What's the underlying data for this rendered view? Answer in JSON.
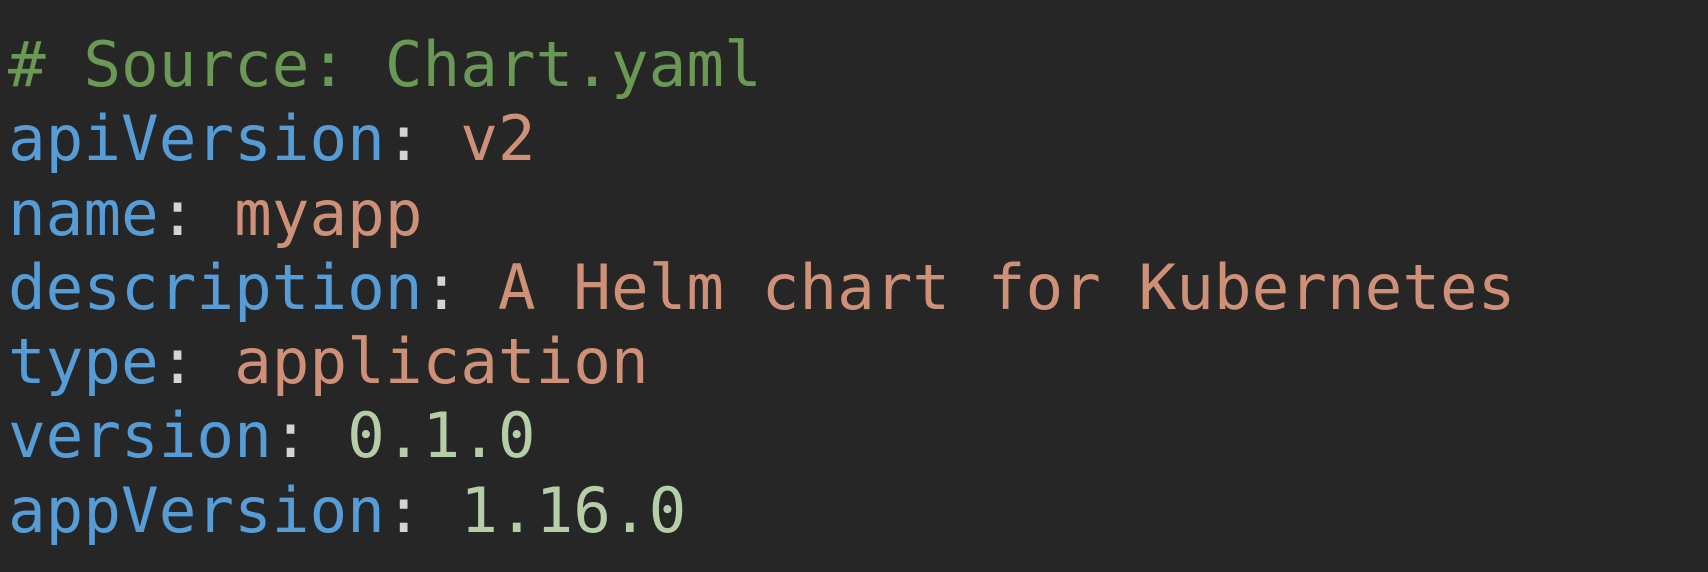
{
  "editor": {
    "language": "yaml",
    "theme": {
      "background": "#262626",
      "comment": "#6a9955",
      "key": "#569cd6",
      "punctuation": "#d4d4d4",
      "string": "#ce9178",
      "number": "#b5cea8"
    },
    "lines": [
      {
        "comment": "# Source: Chart.yaml"
      },
      {
        "key": "apiVersion",
        "sep": ": ",
        "value": "v2",
        "value_type": "string"
      },
      {
        "key": "name",
        "sep": ": ",
        "value": "myapp",
        "value_type": "string"
      },
      {
        "key": "description",
        "sep": ": ",
        "value": "A Helm chart for Kubernetes",
        "value_type": "string"
      },
      {
        "key": "type",
        "sep": ": ",
        "value": "application",
        "value_type": "string"
      },
      {
        "key": "version",
        "sep": ": ",
        "value": "0.1.0",
        "value_type": "number"
      },
      {
        "key": "appVersion",
        "sep": ": ",
        "value": "1.16.0",
        "value_type": "number"
      }
    ]
  }
}
